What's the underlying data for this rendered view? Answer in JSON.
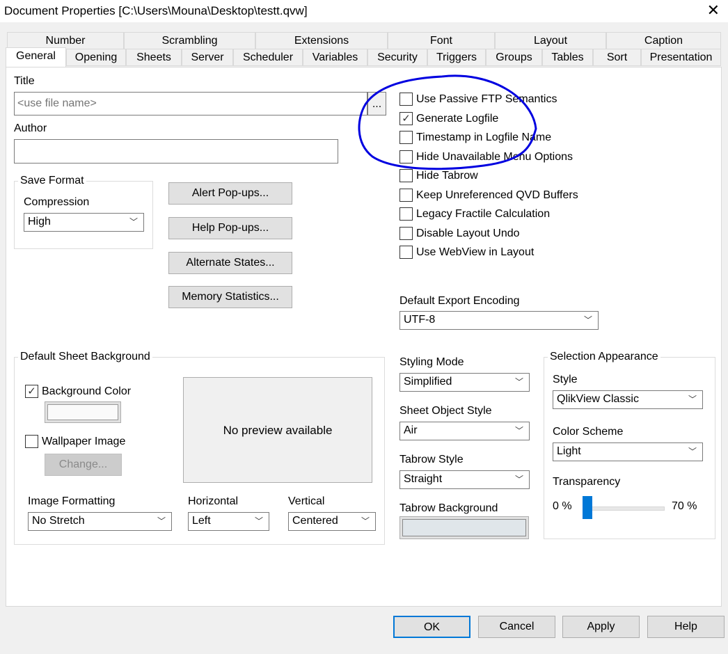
{
  "window": {
    "title": "Document Properties [C:\\Users\\Mouna\\Desktop\\testt.qvw]",
    "close": "✕"
  },
  "tabs_row1": [
    "Number",
    "Scrambling",
    "Extensions",
    "Font",
    "Layout",
    "Caption"
  ],
  "tabs_row2": [
    "General",
    "Opening",
    "Sheets",
    "Server",
    "Scheduler",
    "Variables",
    "Security",
    "Triggers",
    "Groups",
    "Tables",
    "Sort",
    "Presentation"
  ],
  "selected_tab": "General",
  "general": {
    "title_label": "Title",
    "title_placeholder": "<use file name>",
    "browse": "...",
    "author_label": "Author",
    "author_value": "",
    "save_format": "Save Format",
    "compression_label": "Compression",
    "compression_value": "High",
    "buttons": [
      "Alert Pop-ups...",
      "Help Pop-ups...",
      "Alternate States...",
      "Memory Statistics..."
    ],
    "checkboxes": [
      {
        "label": "Use Passive FTP Semantics",
        "checked": false
      },
      {
        "label": "Generate Logfile",
        "checked": true
      },
      {
        "label": "Timestamp in Logfile Name",
        "checked": false
      },
      {
        "label": "Hide Unavailable Menu Options",
        "checked": false
      },
      {
        "label": "Hide Tabrow",
        "checked": false
      },
      {
        "label": "Keep Unreferenced QVD Buffers",
        "checked": false
      },
      {
        "label": "Legacy Fractile Calculation",
        "checked": false
      },
      {
        "label": "Disable Layout Undo",
        "checked": false
      },
      {
        "label": "Use WebView in Layout",
        "checked": false
      }
    ],
    "export_encoding_label": "Default Export Encoding",
    "export_encoding_value": "UTF-8",
    "sheet_bg": {
      "group": "Default Sheet Background",
      "bg_color": "Background Color",
      "bg_checked": true,
      "wallpaper": "Wallpaper Image",
      "wallpaper_checked": false,
      "change": "Change...",
      "preview": "No preview available",
      "image_formatting_label": "Image Formatting",
      "image_formatting": "No Stretch",
      "horizontal_label": "Horizontal",
      "horizontal": "Left",
      "vertical_label": "Vertical",
      "vertical": "Centered"
    },
    "styling_mode_label": "Styling Mode",
    "styling_mode": "Simplified",
    "sheet_object_style_label": "Sheet Object Style",
    "sheet_object_style": "Air",
    "tabrow_style_label": "Tabrow Style",
    "tabrow_style": "Straight",
    "tabrow_bg_label": "Tabrow Background",
    "selection": {
      "group": "Selection Appearance",
      "style_label": "Style",
      "style": "QlikView Classic",
      "color_scheme_label": "Color Scheme",
      "color_scheme": "Light",
      "transparency_label": "Transparency",
      "min": "0 %",
      "max": "70 %",
      "transparency_value": 0
    }
  },
  "footer": {
    "ok": "OK",
    "cancel": "Cancel",
    "apply": "Apply",
    "help": "Help"
  },
  "colors": {
    "annotation": "#0000e0",
    "accent": "#0078d7"
  }
}
